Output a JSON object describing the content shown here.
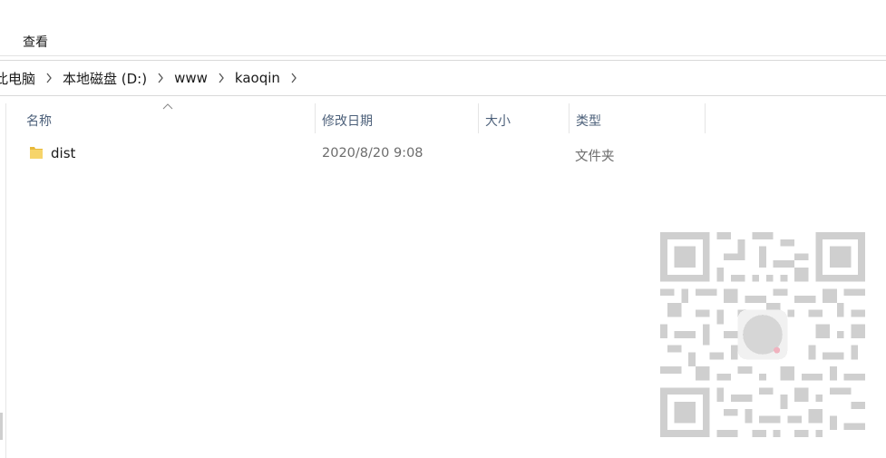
{
  "ribbon": {
    "view_tab": "查看"
  },
  "breadcrumb": {
    "items": [
      "此电脑",
      "本地磁盘 (D:)",
      "www",
      "kaoqin"
    ]
  },
  "columns": {
    "name": "名称",
    "date": "修改日期",
    "size": "大小",
    "type": "类型"
  },
  "files": [
    {
      "name": "dist",
      "date": "2020/8/20 9:08",
      "size": "",
      "type": "文件夹",
      "icon": "folder-icon"
    }
  ],
  "colors": {
    "header_text": "#4c607a",
    "folder": "#f2c94c",
    "qr": "#cfcfcf"
  }
}
